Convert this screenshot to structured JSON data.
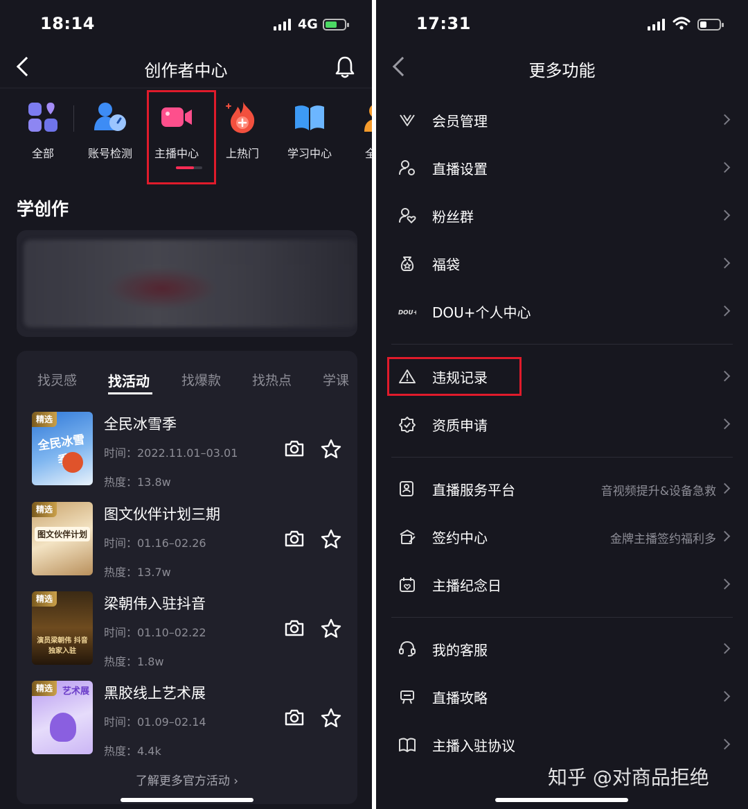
{
  "left": {
    "status": {
      "time": "18:14",
      "network": "4G"
    },
    "nav": {
      "title": "创作者中心"
    },
    "categories": [
      {
        "label": "全部",
        "icon": "grid-icon"
      },
      {
        "label": "账号检测",
        "icon": "account-check-icon"
      },
      {
        "label": "主播中心",
        "icon": "live-camera-icon"
      },
      {
        "label": "上热门",
        "icon": "flame-plus-icon"
      },
      {
        "label": "学习中心",
        "icon": "book-icon"
      },
      {
        "label": "全民",
        "icon": "person-icon"
      }
    ],
    "section_title": "学创作",
    "tabs": [
      "找灵感",
      "找活动",
      "找爆款",
      "找热点",
      "学课"
    ],
    "active_tab": "找活动",
    "activities": [
      {
        "badge": "精选",
        "thumb_text": "全民冰雪季",
        "title": "全民冰雪季",
        "time": "时间：2022.11.01–03.01",
        "heat": "热度：13.8w"
      },
      {
        "badge": "精选",
        "thumb_text": "图文伙伴计划",
        "title": "图文伙伴计划三期",
        "time": "时间：01.16–02.26",
        "heat": "热度：13.7w"
      },
      {
        "badge": "精选",
        "thumb_text": "演员梁朝伟 抖音独家入驻",
        "title": "梁朝伟入驻抖音",
        "time": "时间：01.10–02.22",
        "heat": "热度：1.8w"
      },
      {
        "badge": "精选",
        "thumb_text": "艺术展",
        "title": "黑胶线上艺术展",
        "time": "时间：01.09–02.14",
        "heat": "热度：4.4k"
      }
    ],
    "more_link": "了解更多官方活动 ›"
  },
  "right": {
    "status": {
      "time": "17:31"
    },
    "nav": {
      "title": "更多功能"
    },
    "menu": [
      {
        "label": "会员管理",
        "icon": "vip-v-icon",
        "sub": ""
      },
      {
        "label": "直播设置",
        "icon": "user-settings-icon",
        "sub": ""
      },
      {
        "label": "粉丝群",
        "icon": "fans-group-icon",
        "sub": ""
      },
      {
        "label": "福袋",
        "icon": "lucky-bag-icon",
        "sub": ""
      },
      {
        "label": "DOU+个人中心",
        "icon": "dou-plus-icon",
        "sub": ""
      },
      {
        "label": "违规记录",
        "icon": "warning-icon",
        "sub": ""
      },
      {
        "label": "资质申请",
        "icon": "qualification-icon",
        "sub": ""
      },
      {
        "label": "直播服务平台",
        "icon": "service-platform-icon",
        "sub": "音视频提升&设备急救"
      },
      {
        "label": "签约中心",
        "icon": "sign-center-icon",
        "sub": "金牌主播签约福利多"
      },
      {
        "label": "主播纪念日",
        "icon": "calendar-heart-icon",
        "sub": ""
      },
      {
        "label": "我的客服",
        "icon": "headset-icon",
        "sub": ""
      },
      {
        "label": "直播攻略",
        "icon": "guide-icon",
        "sub": ""
      },
      {
        "label": "主播入驻协议",
        "icon": "agreement-book-icon",
        "sub": ""
      }
    ],
    "watermark": "知乎 @对商品拒绝"
  },
  "colors": {
    "accent": "#fe2c55",
    "highlight_box": "#e01b2b",
    "battery_green": "#4cd964"
  }
}
